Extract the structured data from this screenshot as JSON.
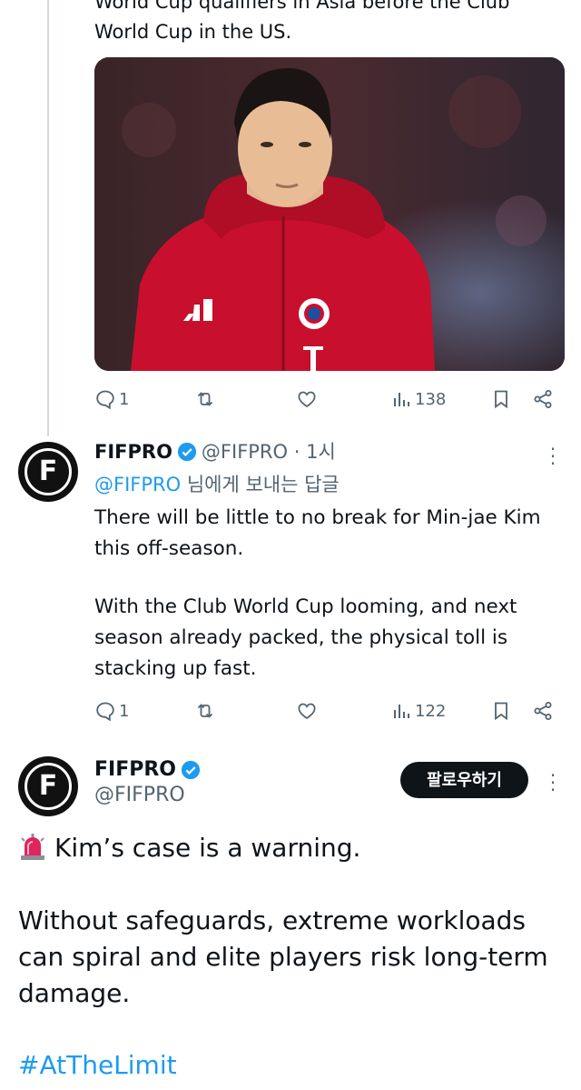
{
  "prev_tweet": {
    "text_tail": "World Cup qualifiers in Asia before the Club World Cup in the US.",
    "actions": {
      "replies": "1",
      "views": "138"
    }
  },
  "reply_tweet": {
    "name": "FIFPRO",
    "handle": "@FIFPRO",
    "separator": " · ",
    "time": "1시",
    "reply_to_mention": "@FIFPRO",
    "reply_to_suffix": " 님에게 보내는 답글",
    "paragraph1": "There will be little to no break for Min-jae Kim this off-season.",
    "paragraph2": "With the Club World Cup looming, and next season already packed, the physical toll is stacking up fast.",
    "actions": {
      "replies": "1",
      "views": "122"
    }
  },
  "main_tweet": {
    "name": "FIFPRO",
    "handle": "@FIFPRO",
    "follow_label": "팔로우하기",
    "line1": "Kim’s case is a warning.",
    "paragraph": "Without safeguards, extreme workloads can spiral and elite players risk long-term damage.",
    "hashtag": "#AtTheLimit"
  },
  "avatar_letter": "F",
  "colors": {
    "accent": "#1d9bf0",
    "muted": "#536471",
    "text": "#0f1419",
    "jersey": "#c8102e"
  }
}
